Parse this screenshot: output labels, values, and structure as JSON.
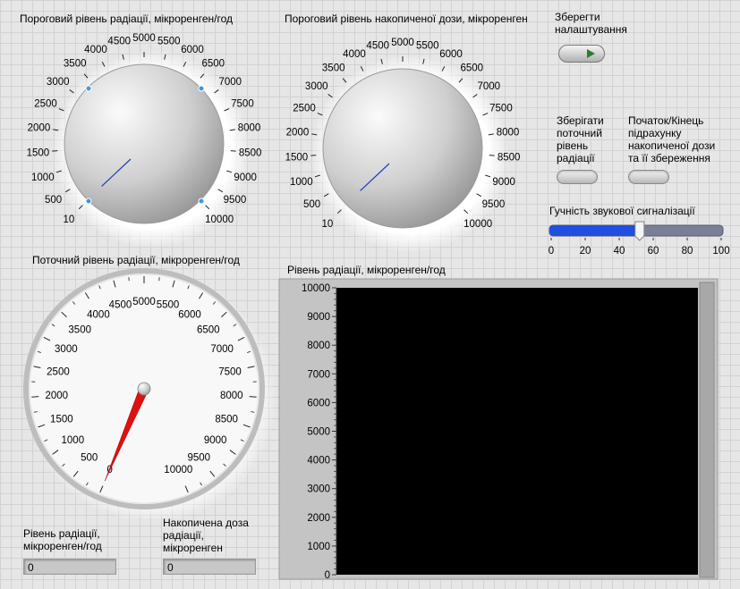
{
  "knob_rate": {
    "label": "Пороговий рівень радіації, мікроренген/год",
    "ticks": [
      "10",
      "500",
      "1000",
      "1500",
      "2000",
      "2500",
      "3000",
      "3500",
      "4000",
      "4500",
      "5000",
      "5500",
      "6000",
      "6500",
      "7000",
      "7500",
      "8000",
      "8500",
      "9000",
      "9500",
      "10000"
    ],
    "value": 10
  },
  "knob_dose": {
    "label": "Пороговий рівень накопиченої дози, мікроренген",
    "ticks": [
      "10",
      "500",
      "1000",
      "1500",
      "2000",
      "2500",
      "3000",
      "3500",
      "4000",
      "4500",
      "5000",
      "5500",
      "6000",
      "6500",
      "7000",
      "7500",
      "8000",
      "8500",
      "9000",
      "9500",
      "10000"
    ],
    "value": 10
  },
  "save": {
    "label": "Зберегти налаштування"
  },
  "toggle_save_current": {
    "label": "Зберігати поточний рівень радіації"
  },
  "toggle_dose_count": {
    "label": "Початок/Кінець підрахунку накопиченої дози та її збереження"
  },
  "volume": {
    "label": "Гучність звукової сигналізації",
    "ticks": [
      "0",
      "20",
      "40",
      "60",
      "80",
      "100"
    ],
    "value": 52
  },
  "gauge": {
    "label": "Поточний рівень радіації, мікроренген/год",
    "ticks": [
      "0",
      "500",
      "1000",
      "1500",
      "2000",
      "2500",
      "3000",
      "3500",
      "4000",
      "4500",
      "5000",
      "5500",
      "6000",
      "6500",
      "7000",
      "7500",
      "8000",
      "8500",
      "9000",
      "9500",
      "10000"
    ],
    "value": 0
  },
  "chart": {
    "label": "Рівень радіації, мікроренген/год"
  },
  "chart_data": {
    "type": "line",
    "title": "Рівень радіації, мікроренген/год",
    "yticks": [
      "0",
      "1000",
      "2000",
      "3000",
      "4000",
      "5000",
      "6000",
      "7000",
      "8000",
      "9000",
      "10000"
    ],
    "ylim": [
      0,
      10000
    ],
    "series": []
  },
  "indicator_rate": {
    "label": "Рівень радіації, мікроренген/год",
    "value": "0"
  },
  "indicator_dose": {
    "label": "Накопичена доза радіації, мікроренген",
    "value": "0"
  }
}
